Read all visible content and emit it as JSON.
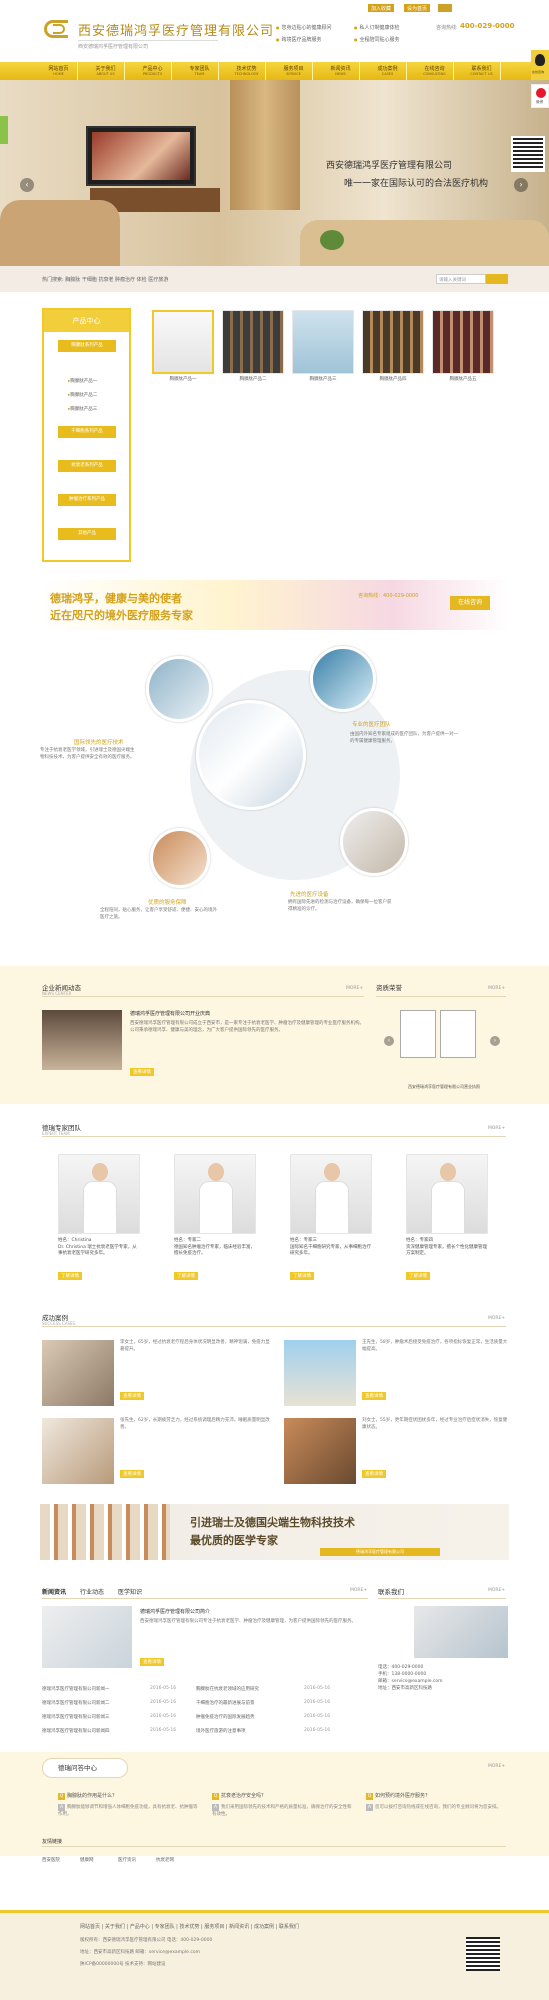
{
  "header": {
    "company_name": "西安德瑞鸿孚医疗管理有限公司",
    "slogan": "西安德瑞鸿孚医疗管理有限公司",
    "links_col1": [
      "您身边贴心的健康顾问",
      "跨境医疗品牌服务"
    ],
    "links_col2": [
      "私人订制健康体检",
      "全程陪同贴心服务"
    ],
    "top_tags": [
      "加入收藏",
      "设为首页"
    ],
    "hotline_label": "咨询热线:",
    "hotline": "400-029-0000"
  },
  "nav": [
    {
      "cn": "网站首页",
      "en": "HOME"
    },
    {
      "cn": "关于我们",
      "en": "ABOUT US"
    },
    {
      "cn": "产品中心",
      "en": "PRODUCTS"
    },
    {
      "cn": "专家团队",
      "en": "TEAM"
    },
    {
      "cn": "技术优势",
      "en": "TECHNOLOGY"
    },
    {
      "cn": "服务项目",
      "en": "SERVICE"
    },
    {
      "cn": "新闻资讯",
      "en": "NEWS"
    },
    {
      "cn": "成功案例",
      "en": "CASES"
    },
    {
      "cn": "在线咨询",
      "en": "CONSULTING"
    },
    {
      "cn": "联系我们",
      "en": "CONTACT US"
    }
  ],
  "banner": {
    "line1": "西安德瑞鸿孚医疗管理有限公司",
    "line2": "唯一一家在国际认可的合法医疗机构"
  },
  "search": {
    "hot_label": "热门搜索:",
    "hot_terms": "胸腺肽 干细胞 抗衰老 肿瘤治疗 体检 医疗旅游",
    "placeholder": "请输入关键词"
  },
  "product_sidebar": {
    "title": "产品中心",
    "groups": [
      {
        "label": "胸腺肽系列产品",
        "items": [
          "胸腺肽产品一",
          "胸腺肽产品二",
          "胸腺肽产品三"
        ]
      },
      {
        "label": "干细胞系列产品"
      },
      {
        "label": "抗衰老系列产品"
      },
      {
        "label": "肿瘤治疗系列产品"
      },
      {
        "label": "其他产品"
      }
    ]
  },
  "products": [
    {
      "caption": "胸腺肽产品一"
    },
    {
      "caption": "胸腺肽产品二"
    },
    {
      "caption": "胸腺肽产品三"
    },
    {
      "caption": "胸腺肽产品四"
    },
    {
      "caption": "胸腺肽产品五"
    }
  ],
  "promo": {
    "line1": "德瑞鸿孚，健康与美的使者",
    "line2": "近在咫尺的境外医疗服务专家",
    "tel": "咨询热线：400-029-0000",
    "button": "在线咨询"
  },
  "advantages": [
    {
      "title": "国际领先的医疗技术",
      "text": "专注于抗衰老医学领域，引进瑞士及德国尖端生物科技技术，为客户提供安全有效的医疗服务。"
    },
    {
      "title": "专业的医疗团队",
      "text": "由国内外知名专家组成的医疗团队，为客户提供一对一的专属健康管理服务。"
    },
    {
      "title": "优质的服务保障",
      "text": "全程陪同，贴心服务，让客户享受舒适、便捷、安心的境外医疗之旅。"
    },
    {
      "title": "先进的医疗设备",
      "text": "拥有国际先进的检测与治疗设备，确保每一位客户获得精准的诊疗。"
    }
  ],
  "news_section": {
    "title": "企业新闻动态",
    "en": "NEWS CENTER",
    "more": "MORE+",
    "headline": "德瑞鸿孚医疗管理有限公司开业庆典",
    "text": "西安德瑞鸿孚医疗管理有限公司成立于西安市，是一家专注于抗衰老医学、肿瘤治疗及健康管理的专业医疗服务机构。公司秉承德瑞鸿孚、健康与美的理念，为广大客户提供国际领先的医疗服务。",
    "button": "查看详情"
  },
  "honor_section": {
    "title": "资质荣誉",
    "more": "MORE+",
    "caption": "西安德瑞鸿孚医疗管理有限公司营业执照"
  },
  "experts_section": {
    "title": "德瑞专家团队",
    "en": "EXPERT TEAM",
    "more": "MORE+",
    "experts": [
      {
        "name": "姓名：Christina",
        "text": "Dr. Christina 瑞士抗衰老医学专家，从事抗衰老医学研究多年。"
      },
      {
        "name": "姓名：专家二",
        "text": "德国知名肿瘤治疗专家，临床经验丰富，擅长免疫治疗。"
      },
      {
        "name": "姓名：专家三",
        "text": "国际知名干细胞研究专家，从事细胞治疗研究多年。"
      },
      {
        "name": "姓名：专家四",
        "text": "资深健康管理专家，擅长个性化健康管理方案制定。"
      }
    ],
    "button": "了解详情"
  },
  "cases_section": {
    "title": "成功案例",
    "en": "SUCCESS CASES",
    "more": "MORE+",
    "cases": [
      {
        "text": "李女士，65岁，经过抗衰老疗程后身体状况明显改善，精神饱满，免疫力显著提升。"
      },
      {
        "text": "王先生，58岁，肿瘤术后接受免疫治疗，各项指标恢复正常，生活质量大幅提高。"
      },
      {
        "text": "张先生，62岁，长期疲劳乏力，经过系统调理后精力充沛，睡眠质量明显改善。"
      },
      {
        "text": "刘女士，55岁，更年期症状困扰多年，经过专业治疗后症状消失，恢复健康状态。"
      }
    ],
    "button": "查看详情"
  },
  "team_banner": {
    "line1": "引进瑞士及德国尖端生物科技技术",
    "line2": "最优质的医学专家",
    "bar": "德瑞鸿孚医疗管理有限公司"
  },
  "bottom_news": {
    "tabs": [
      "新闻资讯",
      "行业动态",
      "医学知识"
    ],
    "more": "MORE+",
    "headline": "德瑞鸿孚医疗管理有限公司简介",
    "intro": "西安德瑞鸿孚医疗管理有限公司专注于抗衰老医学、肿瘤治疗及健康管理，为客户提供国际领先的医疗服务。",
    "button": "查看详情",
    "rows_left": [
      {
        "title": "德瑞鸿孚医疗管理有限公司新闻一",
        "date": "2016-05-16"
      },
      {
        "title": "德瑞鸿孚医疗管理有限公司新闻二",
        "date": "2016-05-16"
      },
      {
        "title": "德瑞鸿孚医疗管理有限公司新闻三",
        "date": "2016-05-16"
      },
      {
        "title": "德瑞鸿孚医疗管理有限公司新闻四",
        "date": "2016-05-16"
      }
    ],
    "rows_right": [
      {
        "title": "胸腺肽在抗衰老领域的应用研究",
        "date": "2016-05-16"
      },
      {
        "title": "干细胞治疗的最新进展与前景",
        "date": "2016-05-16"
      },
      {
        "title": "肿瘤免疫治疗的国际发展趋势",
        "date": "2016-05-16"
      },
      {
        "title": "境外医疗旅游的注意事项",
        "date": "2016-05-16"
      }
    ]
  },
  "contact_section": {
    "title": "联系我们",
    "more": "MORE+",
    "lines": [
      "电话：400-029-0000",
      "手机：138-0000-0000",
      "邮箱：service@example.com",
      "地址：西安市高新区科技路"
    ]
  },
  "faq_section": {
    "title": "德瑞问答中心",
    "more": "MORE+",
    "items": [
      {
        "q": "胸腺肽的作用是什么？",
        "a": "胸腺肽能够调节和增强人体细胞免疫功能，具有抗衰老、抗肿瘤等作用。"
      },
      {
        "q": "抗衰老治疗安全吗？",
        "a": "我们采用国际领先的技术和严格的质量标准，确保治疗的安全性和有效性。"
      },
      {
        "q": "如何预约境外医疗服务？",
        "a": "您可以拨打咨询热线或在线咨询，我们的专业顾问将为您安排。"
      }
    ]
  },
  "links_section": {
    "title": "友情链接",
    "links": [
      "西安医院",
      "健康网",
      "医疗资讯",
      "抗衰老网"
    ]
  },
  "footer": {
    "nav": "网站首页 | 关于我们 | 产品中心 | 专家团队 | 技术优势 | 服务项目 | 新闻资讯 | 成功案例 | 联系我们",
    "lines": [
      "版权所有：西安德瑞鸿孚医疗管理有限公司  电话：400-029-0000",
      "地址：西安市高新区科技路  邮箱：service@example.com",
      "陕ICP备00000000号  技术支持：网站建设"
    ]
  },
  "float": {
    "qq_label": "在线咨询",
    "weibo_label": "微博"
  }
}
